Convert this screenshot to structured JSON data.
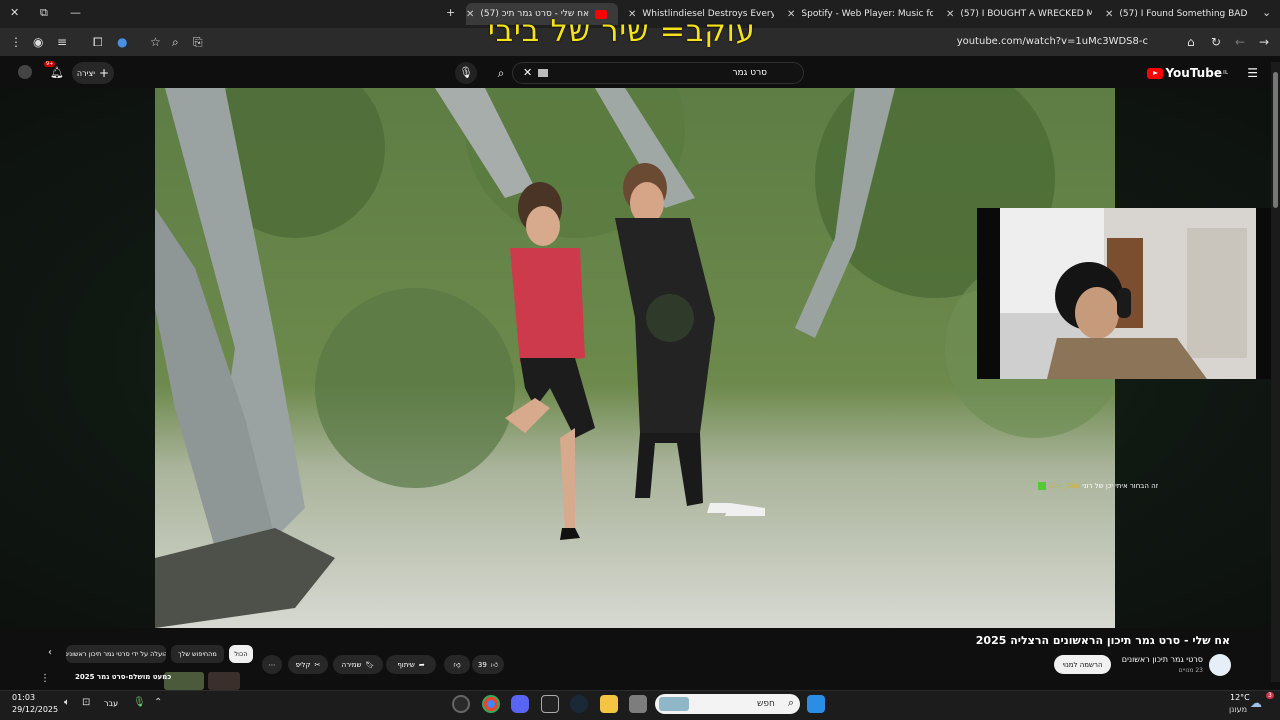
{
  "browser": {
    "tabs": [
      {
        "title": "אח שלי - סרט גמר תיכ (57)",
        "active": true
      },
      {
        "title": "Whistlindiesel Destroys Everyth",
        "active": false
      },
      {
        "title": "Spotify - Web Player: Music for",
        "active": false
      },
      {
        "title": "(57) I BOUGHT A WRECKED ME",
        "active": false
      },
      {
        "title": "(57) I Found Something BAD In",
        "active": false
      }
    ],
    "url": "youtube.com/watch?v=1uMc3WDS8-c"
  },
  "overlay": {
    "caption": "עוקב= שיר של ביבי"
  },
  "youtube": {
    "logo": "YouTube",
    "logo_region": "IL",
    "search_query": "סרט גמר",
    "create_label": "יצירה",
    "notifications_count": "9+"
  },
  "video": {
    "title": "אח שלי - סרט גמר תיכון הראשונים הרצליה 2025",
    "channel_name": "סרטי גמר תיכון ראשונים",
    "subscribers": "23 מנויים",
    "subscribe_label": "הרשמה למנוי",
    "likes": "39",
    "share_label": "שיתוף",
    "save_label": "שמירה",
    "clip_label": "קליפ"
  },
  "chat": {
    "username": "Lion_Abu",
    "message": "זה הבחור איתי יכן של רוני"
  },
  "recommendations": {
    "chips": [
      "הכול",
      "מהחיפוש שלך",
      "הועלה על ידי סרטי גמר תיכון ראשונים"
    ],
    "first_title": "כמעט מושלם-סרט גמר 2025"
  },
  "taskbar": {
    "time": "01:03",
    "date": "29/12/2025",
    "language": "עבר",
    "search_placeholder": "חפש",
    "weather_temp": "12°C",
    "weather_desc": "מעונן",
    "weather_badge": "3"
  },
  "colors": {
    "youtube_red": "#ff0000",
    "caption_yellow": "#f5e21a",
    "spotify_green": "#1db954"
  }
}
